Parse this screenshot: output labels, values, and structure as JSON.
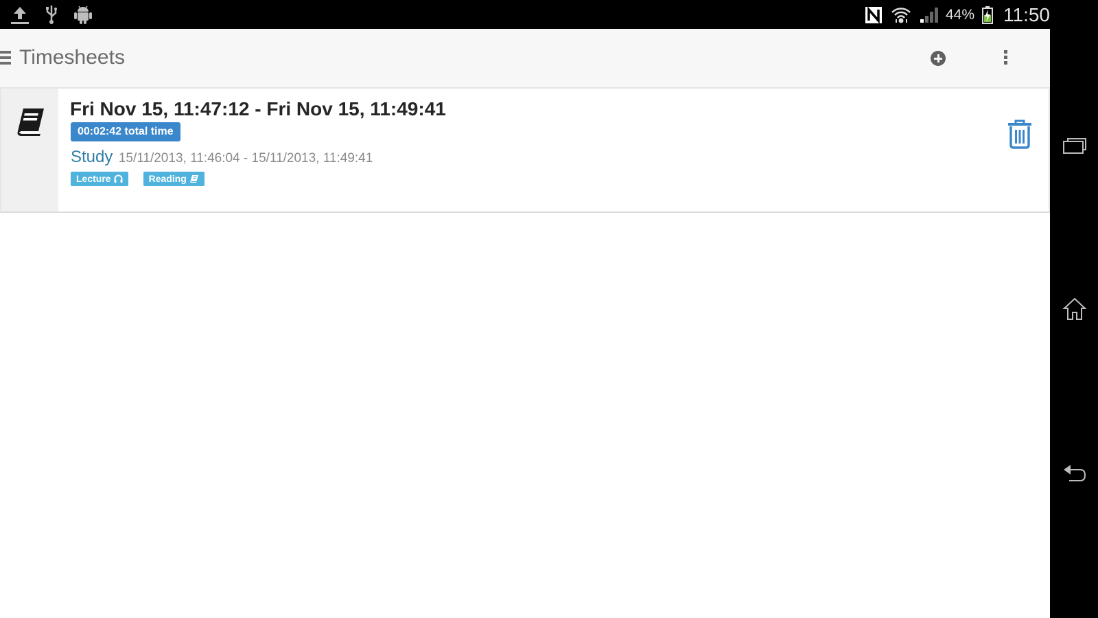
{
  "status_bar": {
    "left_icons": [
      "upload-icon",
      "usb-icon",
      "android-debug-icon"
    ],
    "right_icons": [
      "nfc-icon",
      "wifi-icon",
      "signal-icon",
      "battery-charging-icon"
    ],
    "battery_percent": "44%",
    "clock": "11:50"
  },
  "action_bar": {
    "title": "Timesheets",
    "menu_icon": "menu-icon",
    "add_icon": "add-circle-icon",
    "overflow_icon": "overflow-menu-icon"
  },
  "timesheets": [
    {
      "icon": "book-icon",
      "title": "Fri Nov 15, 11:47:12 - Fri Nov 15, 11:49:41",
      "total_time": "00:02:42 total time",
      "project": "Study",
      "project_range": "15/11/2013, 11:46:04 - 15/11/2013, 11:49:41",
      "tags": [
        {
          "label": "Lecture",
          "icon": "headphones-icon"
        },
        {
          "label": "Reading",
          "icon": "book-icon"
        }
      ],
      "delete_icon": "trash-icon"
    }
  ],
  "nav_bar": {
    "buttons": [
      "recent-apps",
      "home",
      "back"
    ]
  },
  "colors": {
    "accent_blue": "#3b87cc",
    "tag_blue": "#4fb3dd",
    "project_blue": "#2f7fa8"
  }
}
